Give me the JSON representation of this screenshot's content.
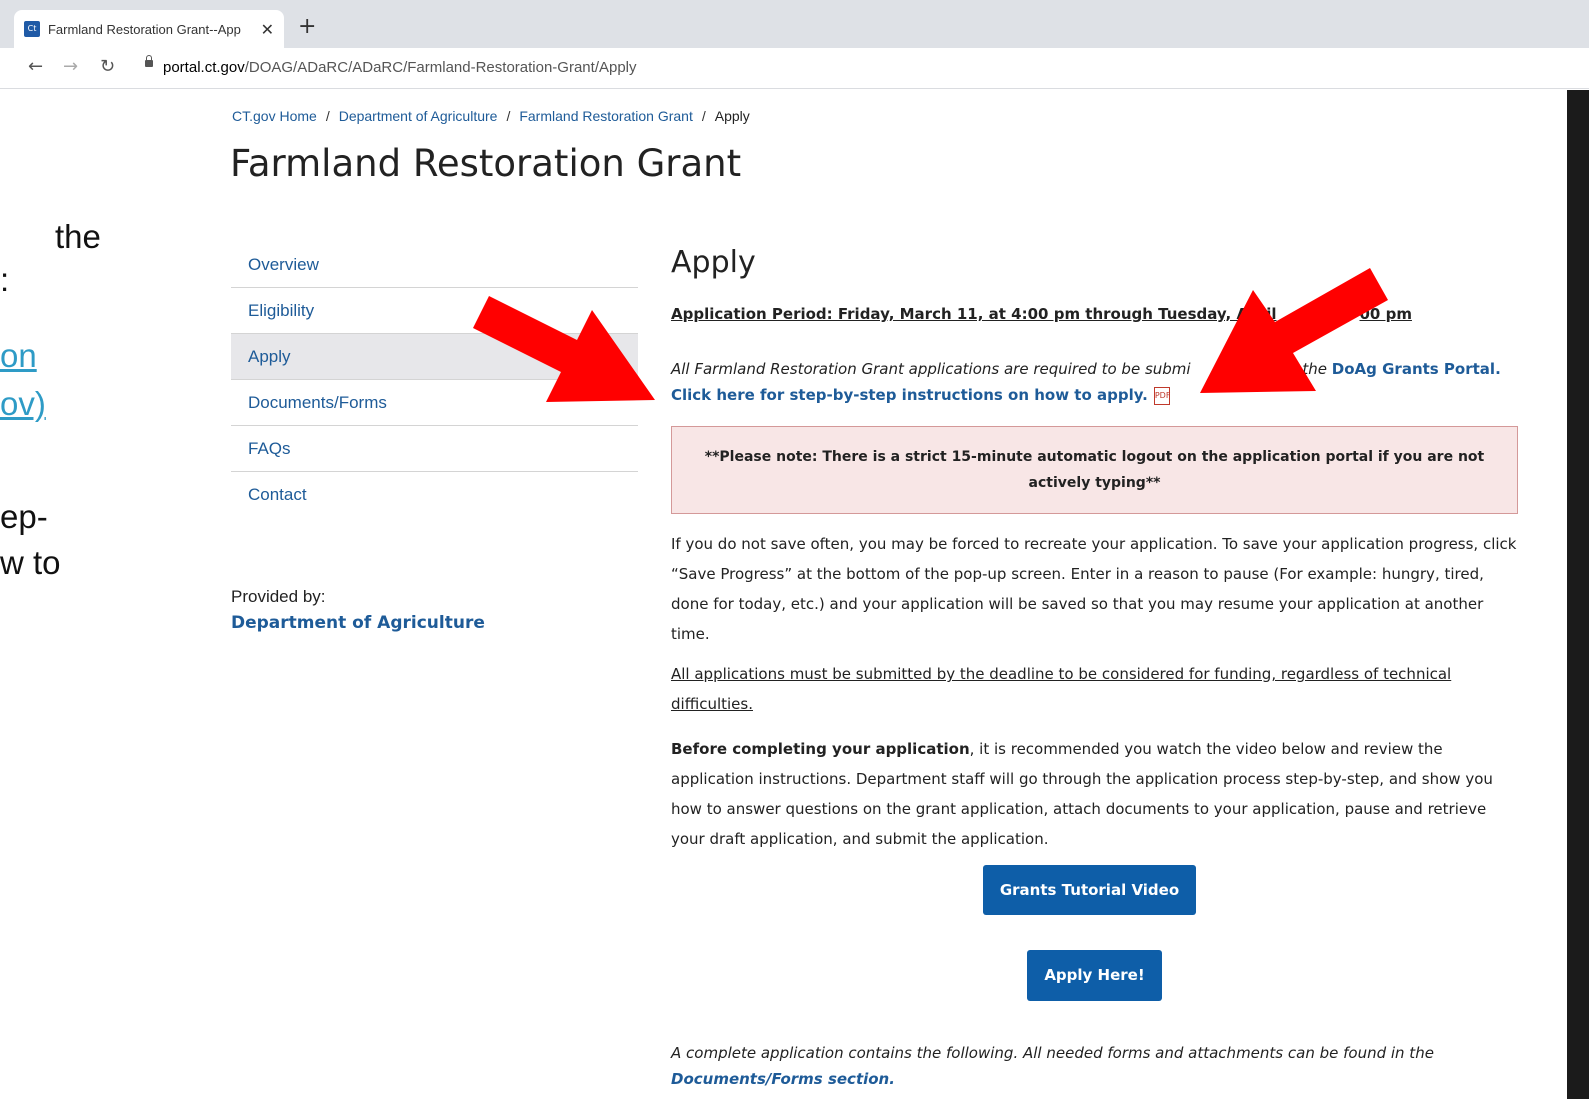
{
  "browser": {
    "tab_title": "Farmland Restoration Grant--App",
    "favicon_text": "Ct",
    "close_glyph": "✕",
    "new_tab_glyph": "+",
    "url_host": "portal.ct.gov",
    "url_path": "/DOAG/ADaRC/ADaRC/Farmland-Restoration-Grant/Apply"
  },
  "overlay_text": [
    "the",
    ":",
    "on",
    "ov)",
    "ep-",
    "w to"
  ],
  "breadcrumb": [
    "CT.gov Home",
    "Department of Agriculture",
    "Farmland Restoration Grant",
    "Apply"
  ],
  "page_title": "Farmland Restoration Grant",
  "sidebar": {
    "items": [
      "Overview",
      "Eligibility",
      "Apply",
      "Documents/Forms",
      "FAQs",
      "Contact"
    ],
    "active": "Apply",
    "provided_label": "Provided by:",
    "provider": "Department of Agriculture"
  },
  "main": {
    "heading": "Apply",
    "period": "Application Period: Friday, March 11, at 4:00 pm through Tuesday, April",
    "period_end": "00 pm",
    "intro_text": "All Farmland Restoration Grant applications are required to be submi",
    "intro_text_end": "gh the",
    "portal_link": "DoAg Grants Portal.",
    "instructions_link": "Click here for step-by-step instructions on how to apply.",
    "notice": "**Please note: There is a strict 15-minute automatic logout on the application portal if you are not actively typing**",
    "save_para": "If you do not save often, you may be forced to recreate your application. To save your application progress, click “Save Progress” at the bottom of the pop-up screen. Enter in a reason to pause (For example: hungry, tired, done for today, etc.) and your application will be saved so that you may resume your application at another time.",
    "deadline_para": "All applications must be submitted by the deadline to be considered for funding, regardless of technical difficulties.",
    "before_bold": "Before completing your application",
    "before_rest": ", it is recommended you watch the video below and review the application instructions. Department staff will go through the application process step-by-step, and show you how to answer questions on the grant application, attach documents to your application, pause and retrieve your draft application, and submit the application.",
    "tutorial_button": "Grants Tutorial Video",
    "apply_button": "Apply Here!",
    "foot_text": "A complete application contains the following. All needed forms and attachments can be found in the",
    "foot_link": "Documents/Forms section."
  },
  "colors": {
    "link": "#1e5b98",
    "button": "#0e5ea8",
    "arrow": "#ff0000",
    "notice_bg": "#f8e6e6"
  }
}
